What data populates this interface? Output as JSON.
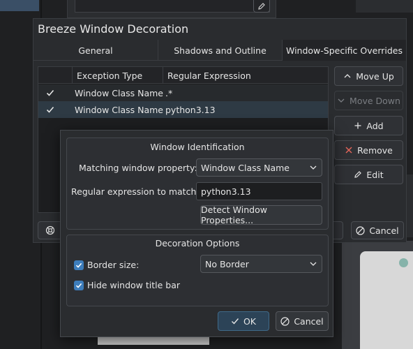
{
  "main_dialog": {
    "title": "Breeze Window Decoration",
    "tabs": [
      {
        "label": "General",
        "active": false
      },
      {
        "label": "Shadows and Outline",
        "active": false
      },
      {
        "label": "Window-Specific Overrides",
        "active": true
      }
    ],
    "table": {
      "columns": [
        "Exception Type",
        "Regular Expression"
      ],
      "rows": [
        {
          "checked": true,
          "type": "Window Class Name",
          "regex": ".*"
        },
        {
          "checked": true,
          "type": "Window Class Name",
          "regex": "python3.13"
        }
      ]
    },
    "side_buttons": {
      "move_up": "Move Up",
      "move_down": "Move Down",
      "add": "Add",
      "remove": "Remove",
      "edit": "Edit"
    },
    "cancel_label": "Cancel"
  },
  "override_dialog": {
    "identification": {
      "title": "Window Identification",
      "matching_label": "Matching window property:",
      "matching_value": "Window Class Name",
      "regex_label": "Regular expression to match:",
      "regex_value": "python3.13",
      "detect_label": "Detect Window Properties..."
    },
    "decoration": {
      "title": "Decoration Options",
      "border_size_label": "Border size:",
      "border_size_checked": true,
      "border_size_value": "No Border",
      "hide_title_label": "Hide window title bar",
      "hide_title_checked": true
    },
    "ok_label": "OK",
    "cancel_label": "Cancel"
  },
  "colors": {
    "accent": "#3d7dbb",
    "background": "#1f2022",
    "dialog": "#2a2c2f"
  }
}
